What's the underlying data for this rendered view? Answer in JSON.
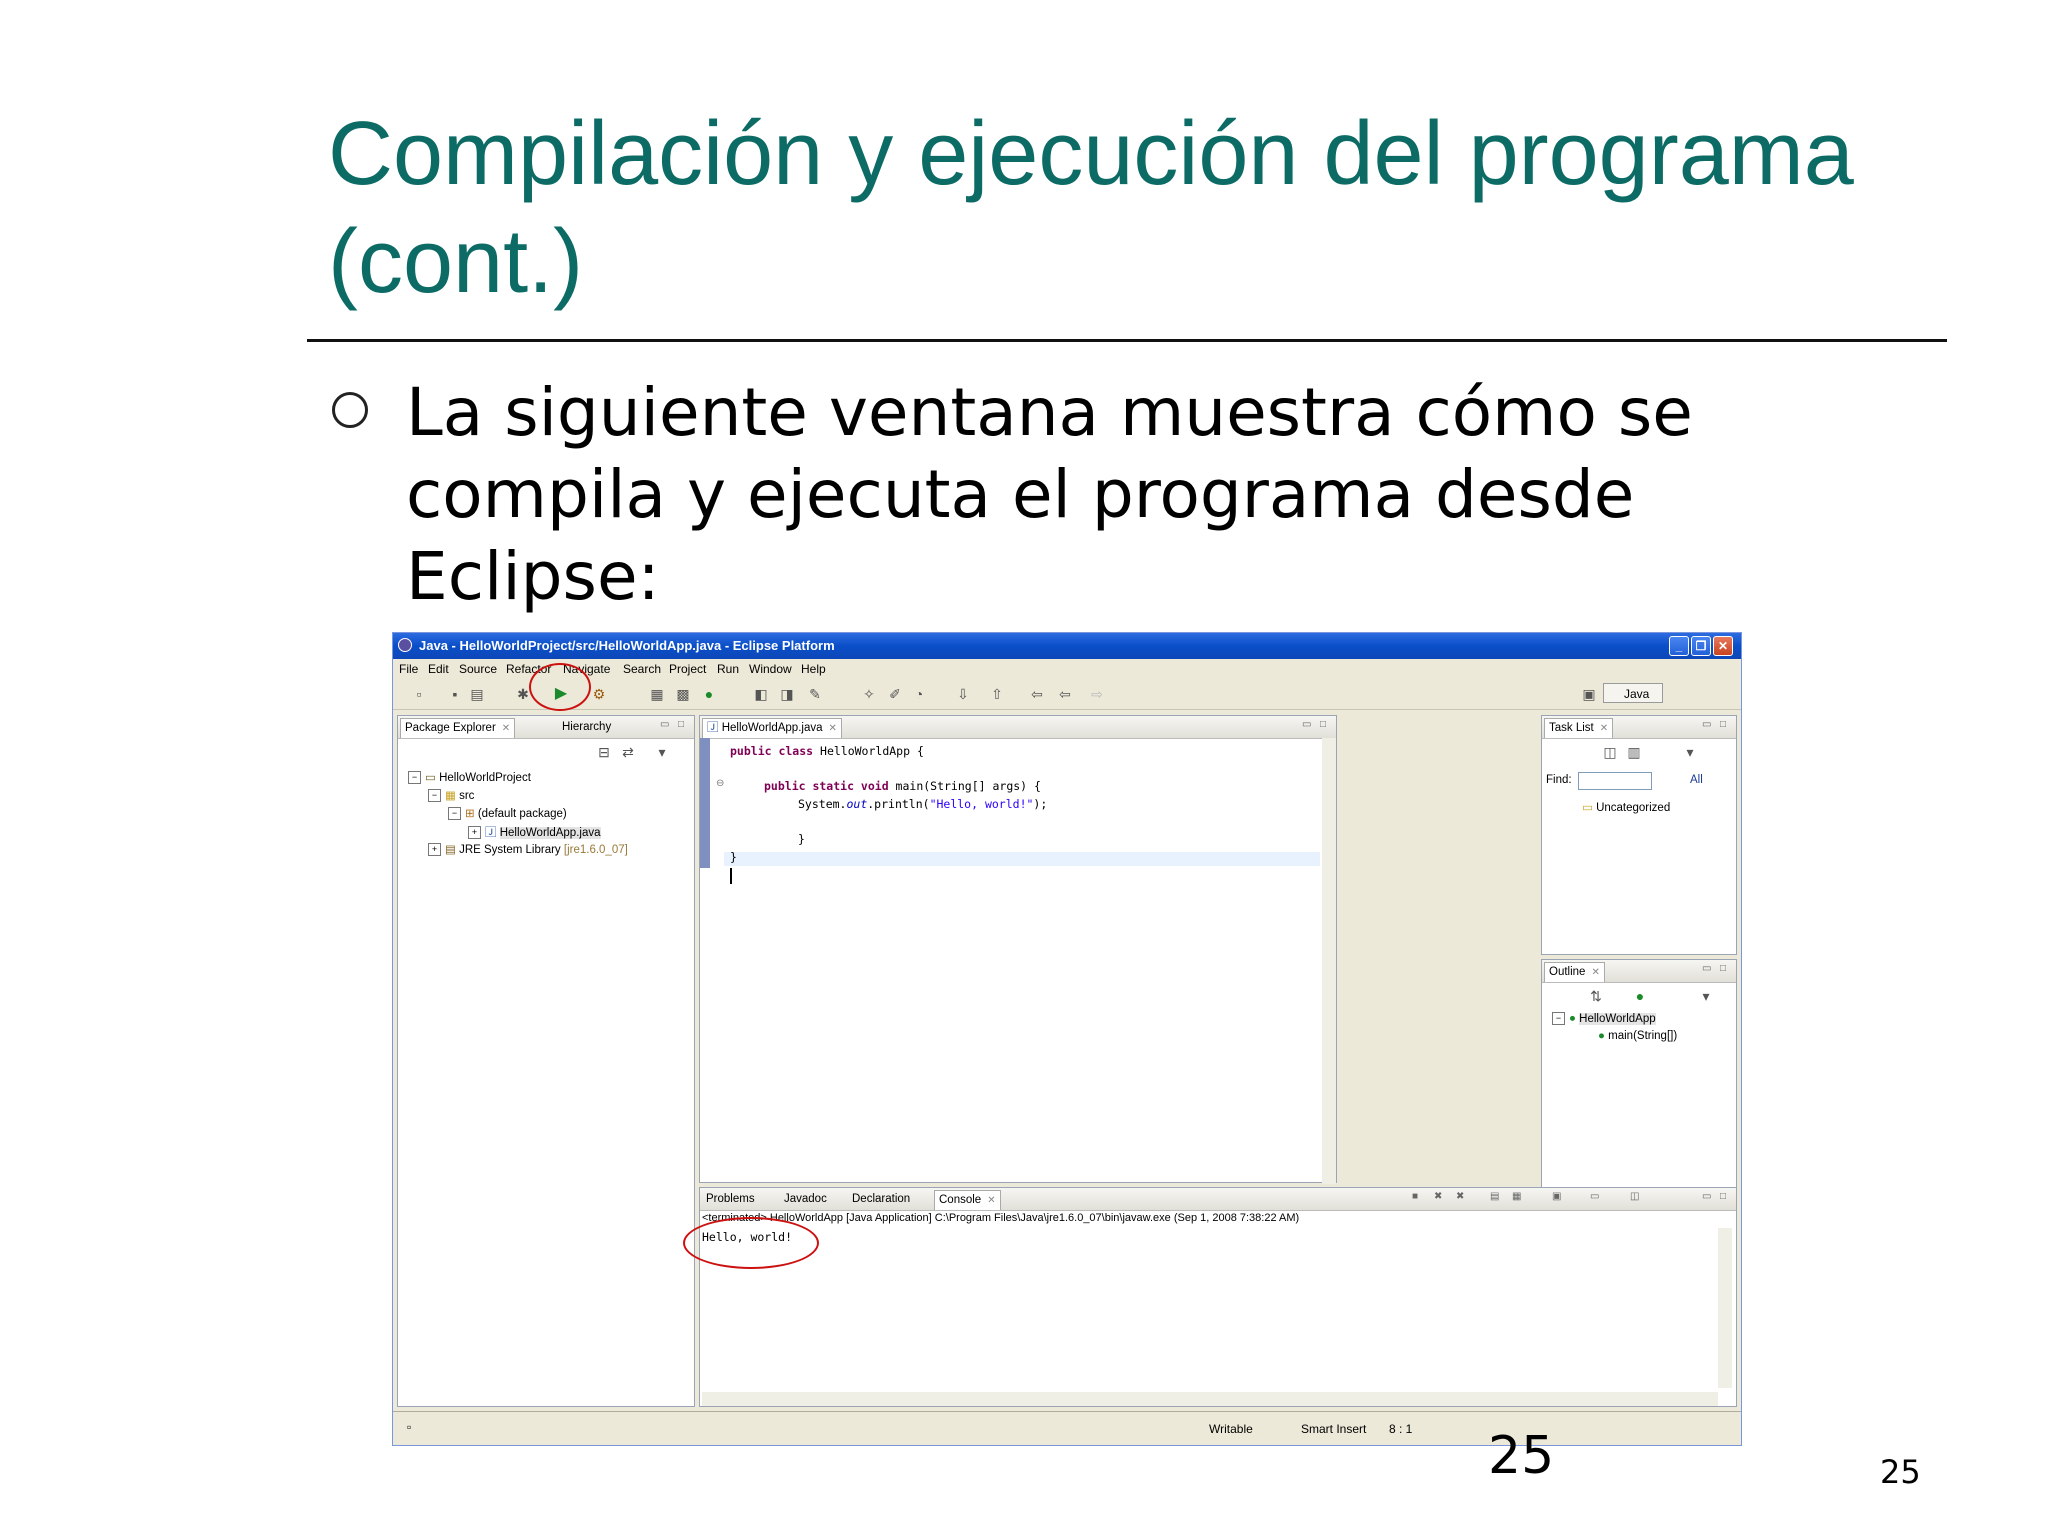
{
  "slide": {
    "title": "Compilación y ejecución del programa (cont.)",
    "bullet": "La siguiente ventana muestra cómo se compila y ejecuta el programa desde Eclipse:",
    "page_number_big": "25",
    "page_number_small": "25"
  },
  "window": {
    "title": "Java - HelloWorldProject/src/HelloWorldApp.java - Eclipse Platform",
    "menu": [
      "File",
      "Edit",
      "Source",
      "Refactor",
      "Navigate",
      "Search",
      "Project",
      "Run",
      "Window",
      "Help"
    ],
    "perspective": "Java"
  },
  "package_explorer": {
    "tabs": [
      "Package Explorer",
      "Hierarchy"
    ],
    "tree": {
      "project": "HelloWorldProject",
      "src": "src",
      "package": "(default package)",
      "file": "HelloWorldApp.java",
      "library": "JRE System Library",
      "library_version": "[jre1.6.0_07]"
    }
  },
  "editor": {
    "tab": "HelloWorldApp.java",
    "code": {
      "l1_kw": "public class",
      "l1_rest": " HelloWorldApp {",
      "l2_kw": "public static void",
      "l2_rest": " main(String[] args) {",
      "l3_a": "System.",
      "l3_field": "out",
      "l3_b": ".println(",
      "l3_str": "\"Hello, world!\"",
      "l3_c": ");",
      "l4": "}",
      "l5": "}"
    }
  },
  "task_list": {
    "tab": "Task List",
    "find_label": "Find:",
    "all_label": "All",
    "category": "Uncategorized"
  },
  "outline": {
    "tab": "Outline",
    "class": "HelloWorldApp",
    "method": "main(String[])"
  },
  "console": {
    "tabs": [
      "Problems",
      "Javadoc",
      "Declaration",
      "Console"
    ],
    "header": "<terminated> HelloWorldApp [Java Application] C:\\Program Files\\Java\\jre1.6.0_07\\bin\\javaw.exe (Sep 1, 2008 7:38:22 AM)",
    "output": "Hello, world!"
  },
  "status": {
    "writable": "Writable",
    "insert_mode": "Smart Insert",
    "position": "8 : 1"
  },
  "colors": {
    "title": "#0d6b66",
    "highlight": "#cc1111",
    "titlebar": "#0a4fc8"
  }
}
